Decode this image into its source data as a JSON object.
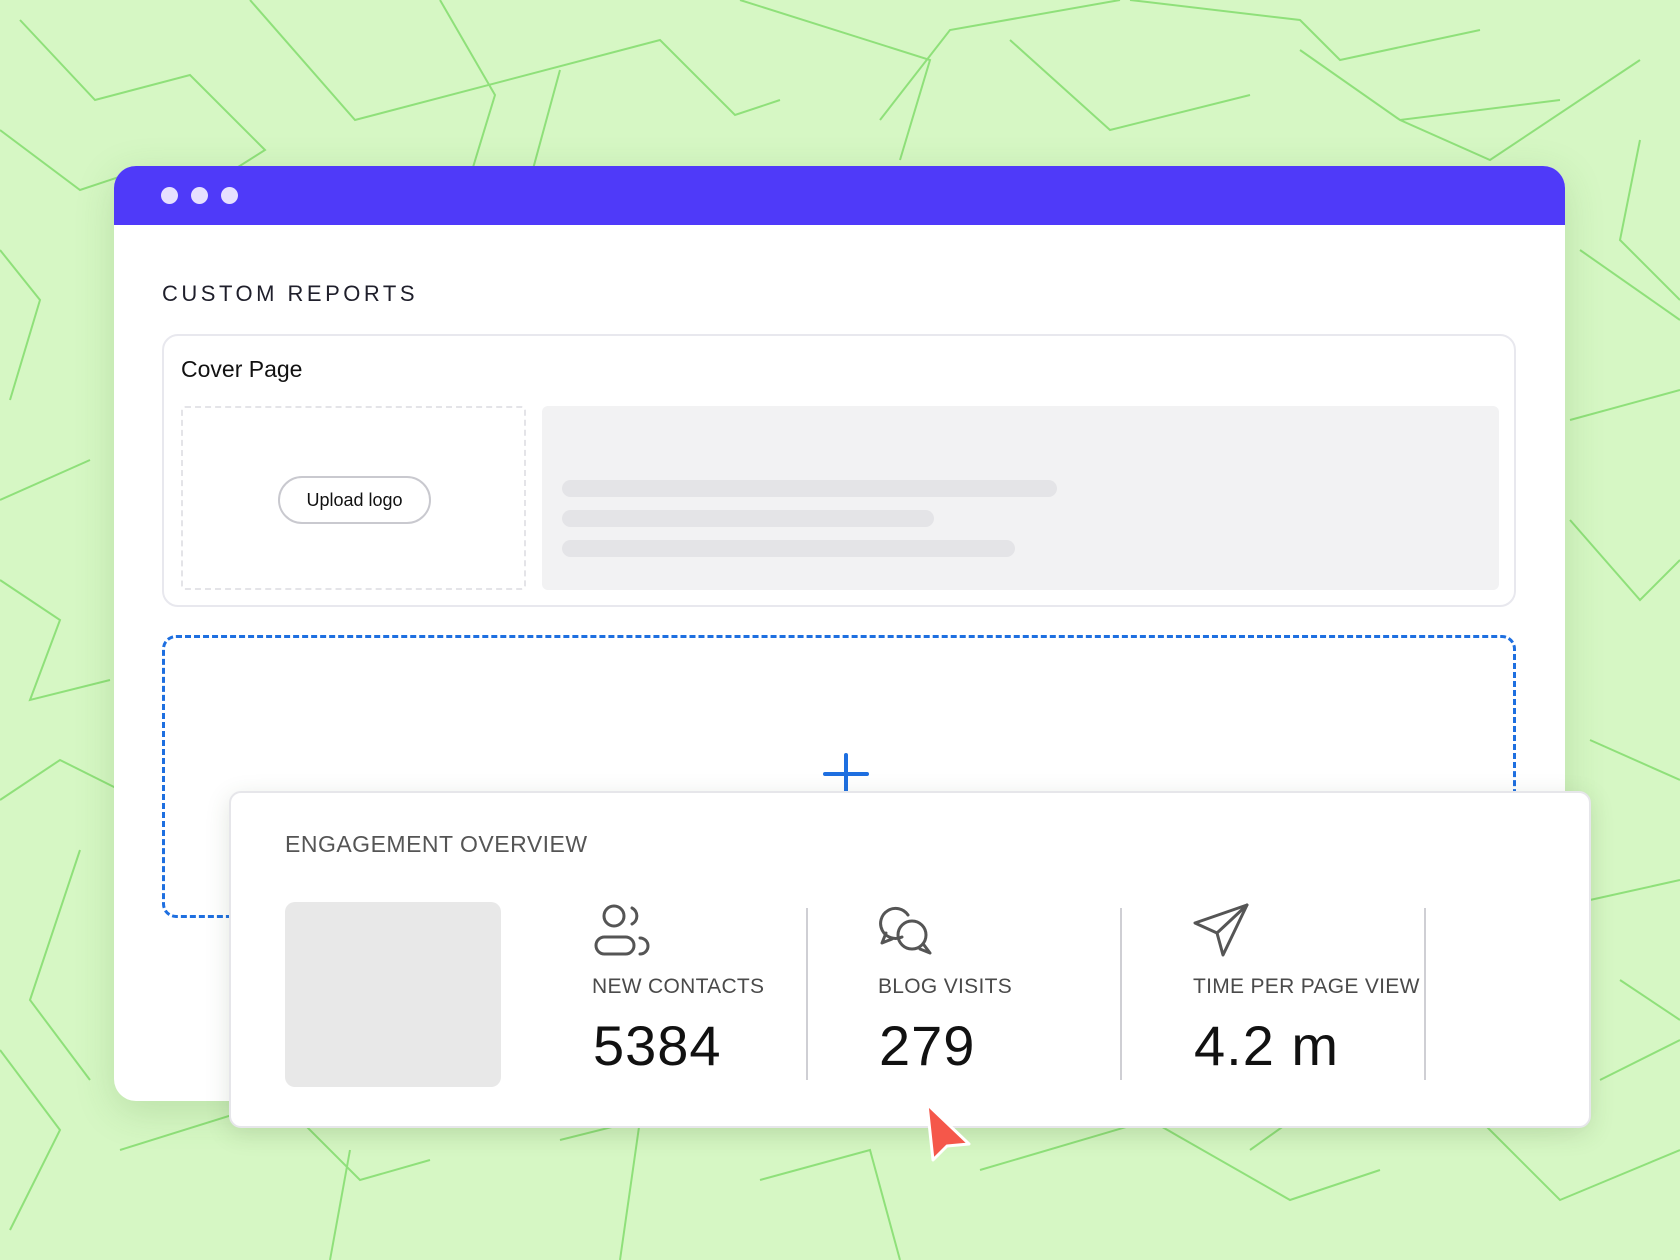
{
  "window": {
    "title": "CUSTOM REPORTS"
  },
  "cover": {
    "title": "Cover Page",
    "upload_button": "Upload logo"
  },
  "drop_zone": {
    "icon": "plus-icon"
  },
  "engagement": {
    "title": "ENGAGEMENT OVERVIEW",
    "metrics": [
      {
        "icon": "contacts-icon",
        "label": "NEW CONTACTS",
        "value": "5384"
      },
      {
        "icon": "chat-bubbles-icon",
        "label": "BLOG VISITS",
        "value": "279"
      },
      {
        "icon": "send-icon",
        "label": "TIME PER PAGE VIEW",
        "value": "4.2 m"
      }
    ]
  },
  "colors": {
    "background": "#d6f7c4",
    "titlebar": "#4f3af9",
    "accent_blue": "#1e6fe0",
    "cursor": "#f5574a"
  }
}
